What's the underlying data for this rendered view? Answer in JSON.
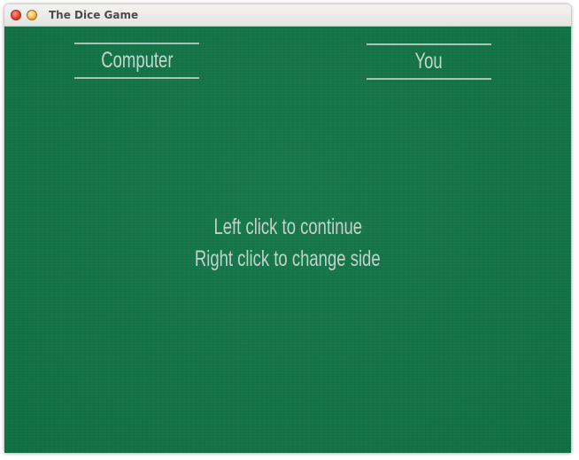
{
  "window": {
    "title": "The Dice Game"
  },
  "players": {
    "computer_label": "Computer",
    "you_label": "You"
  },
  "instructions": {
    "left_click": "Left click to continue",
    "right_click": "Right click to change side"
  },
  "colors": {
    "felt": "#117446",
    "text": "#c7d6cd",
    "label_rule": "#a9c3b6"
  }
}
